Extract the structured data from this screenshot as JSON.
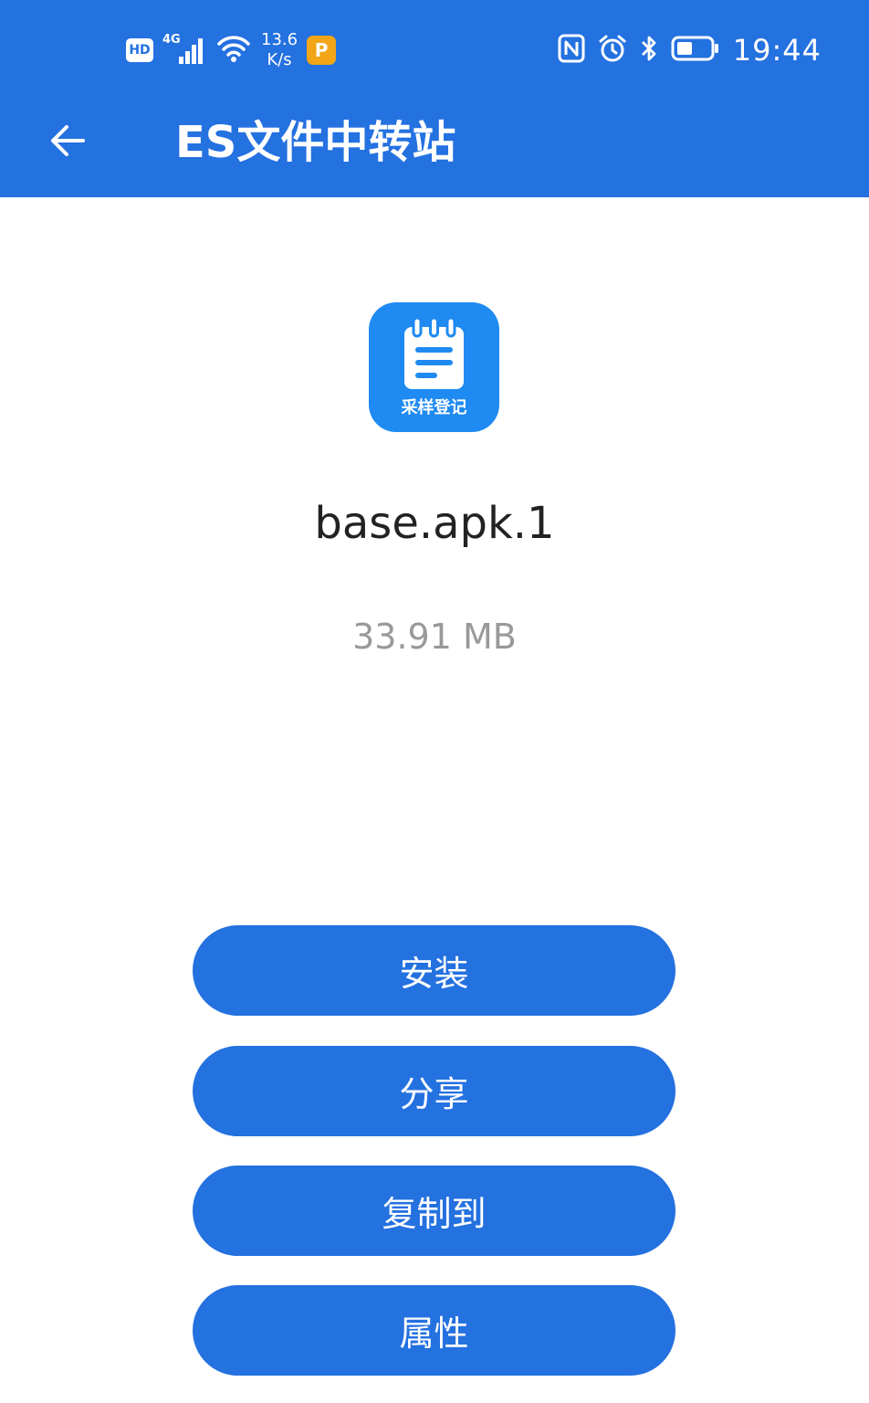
{
  "status_bar": {
    "hd_label": "HD",
    "network_label": "4G",
    "speed_value": "13.6",
    "speed_unit": "K/s",
    "time": "19:44",
    "icons": [
      "hd-icon",
      "signal-icon",
      "wifi-icon",
      "app-notification-icon",
      "nfc-icon",
      "alarm-icon",
      "bluetooth-icon",
      "battery-icon"
    ]
  },
  "toolbar": {
    "title": "ES文件中转站",
    "back_icon": "arrow-left-icon"
  },
  "file": {
    "app_icon_label": "采样登记",
    "name": "base.apk.1",
    "size": "33.91 MB"
  },
  "actions": {
    "install": "安装",
    "share": "分享",
    "copy_to": "复制到",
    "properties": "属性"
  },
  "colors": {
    "primary": "#2471e0",
    "app_icon_bg": "#1f8af2",
    "text_primary": "#222222",
    "text_secondary": "#999999"
  }
}
